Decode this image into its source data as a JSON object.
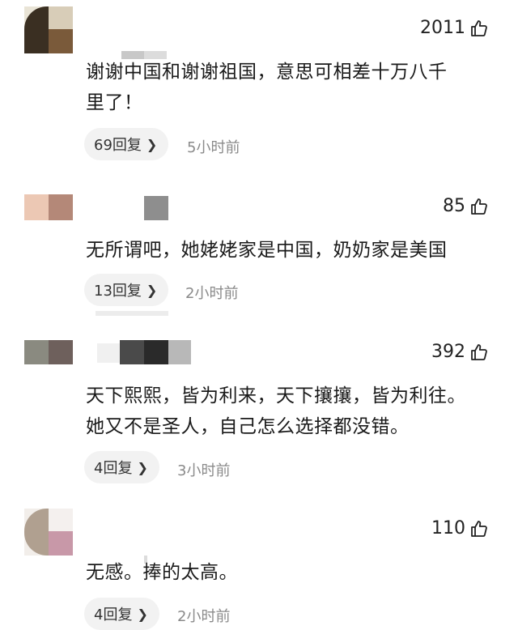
{
  "comments": [
    {
      "likes": "2011",
      "text_lines": [
        "谢谢中国和谢谢祖国，意思可相差十万八千",
        "里了！"
      ],
      "replies": "69回复",
      "time": "5小时前"
    },
    {
      "likes": "85",
      "text_lines": [
        "无所谓吧，她姥姥家是中国，奶奶家是美国"
      ],
      "replies": "13回复",
      "time": "2小时前"
    },
    {
      "likes": "392",
      "text_lines": [
        "天下熙熙，皆为利来，天下攘攘，皆为利往。",
        "她又不是圣人，自己怎么选择都没错。"
      ],
      "replies": "4回复",
      "time": "3小时前"
    },
    {
      "likes": "110",
      "text_lines": [
        "无感。捧的太高。"
      ],
      "replies": "4回复",
      "time": "2小时前"
    }
  ],
  "icons": {
    "like": "thumbs-up-icon",
    "chevron": "chevron-right-icon"
  }
}
